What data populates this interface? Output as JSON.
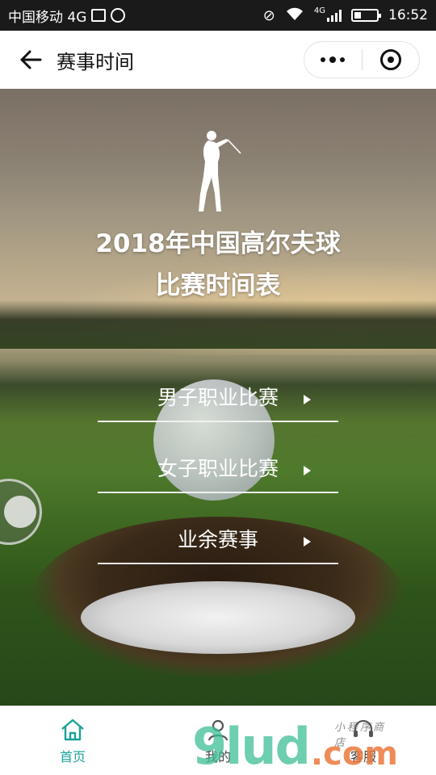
{
  "status_bar": {
    "carrier": "中国移动 4G",
    "network": "4G",
    "time": "16:52",
    "battery_level": 0.3,
    "icons": [
      "image-icon",
      "face-icon",
      "mute-icon",
      "wifi-icon",
      "signal-icon",
      "battery-icon"
    ]
  },
  "nav": {
    "title": "赛事时间",
    "back_icon": "arrow-left-icon",
    "more_icon": "more-dots-icon",
    "close_icon": "target-circle-icon"
  },
  "hero": {
    "title_line1": "2018年中国高尔夫球",
    "title_line2": "比赛时间表",
    "golfer_icon": "golfer-silhouette-icon"
  },
  "menu": {
    "items": [
      {
        "label": "男子职业比赛"
      },
      {
        "label": "女子职业比赛"
      },
      {
        "label": "业余赛事"
      }
    ]
  },
  "tabbar": {
    "items": [
      {
        "label": "首页",
        "icon": "home-icon",
        "active": true
      },
      {
        "label": "我的",
        "icon": "user-icon",
        "active": false
      },
      {
        "label": "客服",
        "icon": "headset-icon",
        "active": false
      }
    ],
    "active_color": "#1aa29a"
  },
  "watermark": {
    "main": "9lud",
    "suffix": ".com",
    "small": "小程序商店"
  }
}
